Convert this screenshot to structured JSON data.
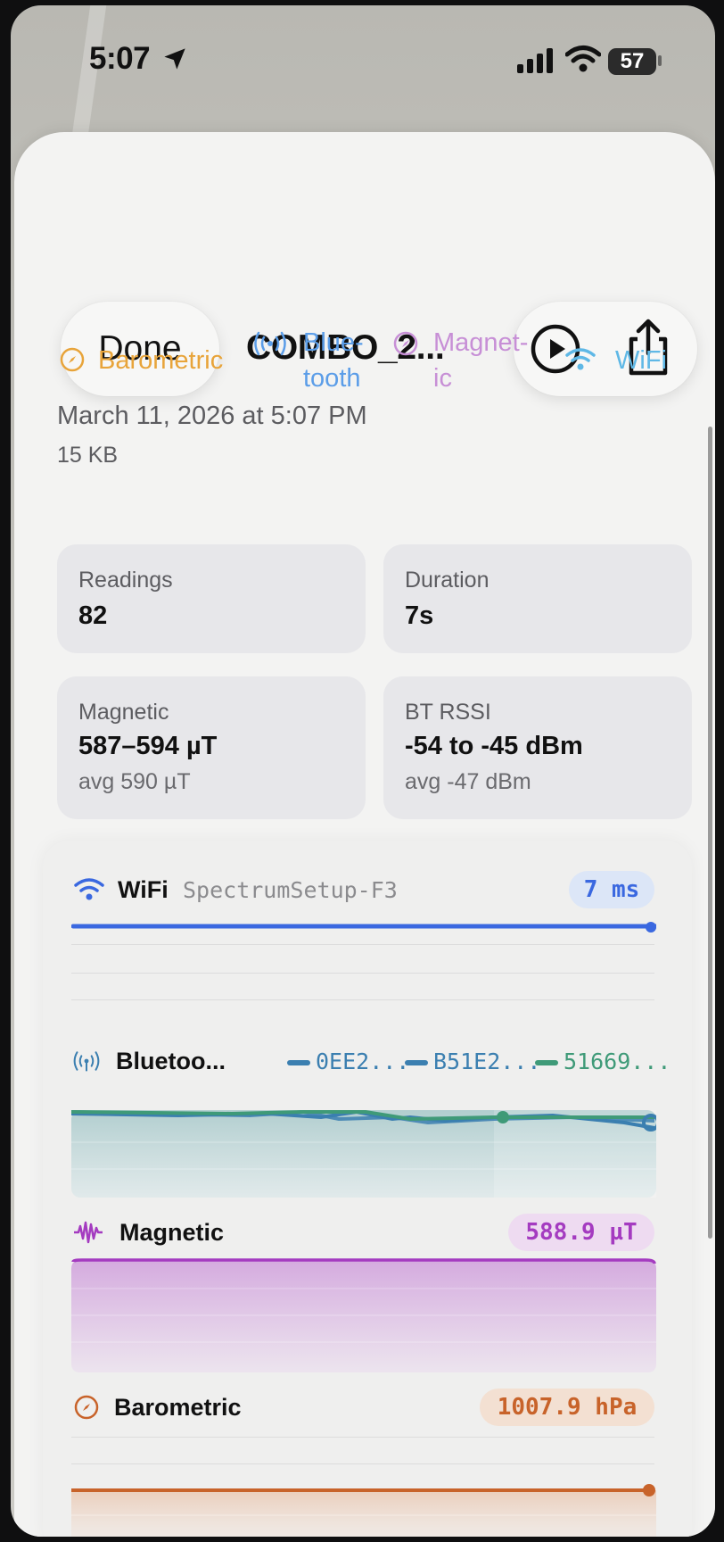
{
  "status_bar": {
    "time": "5:07",
    "battery": "57"
  },
  "header": {
    "done_label": "Done",
    "title": "COMBO_2..."
  },
  "tags": [
    {
      "label": "Barometric",
      "color": "#e8a43a",
      "icon": "compass-icon"
    },
    {
      "label": "Blue-\ntooth",
      "color": "#5b9de8",
      "icon": "antenna-icon"
    },
    {
      "label": "Magnet-\nic",
      "color": "#c78fd6",
      "icon": "compass-icon"
    },
    {
      "label": "WiFi",
      "color": "#5fb8e6",
      "icon": "wifi-icon"
    }
  ],
  "recording": {
    "date": "March 11, 2026 at 5:07 PM",
    "size": "15 KB"
  },
  "stats": {
    "readings": {
      "label": "Readings",
      "value": "82"
    },
    "duration": {
      "label": "Duration",
      "value": "7s"
    },
    "magnetic": {
      "label": "Magnetic",
      "value": "587–594 µT",
      "avg": "avg 590 µT"
    },
    "bt_rssi": {
      "label": "BT RSSI",
      "value": "-54 to -45 dBm",
      "avg": "avg -47 dBm"
    }
  },
  "charts": {
    "wifi": {
      "label": "WiFi",
      "network": "SpectrumSetup-F3",
      "badge": "7 ms",
      "color": "#3a68e0"
    },
    "bluetooth": {
      "label": "Bluetoo...",
      "devices": [
        "0EE2...",
        "B51E2...",
        "51669..."
      ],
      "device_colors": [
        "#3b7fb0",
        "#3b7fb0",
        "#3f9a78"
      ]
    },
    "magnetic": {
      "label": "Magnetic",
      "badge": "588.9 µT",
      "color": "#a43bc0"
    },
    "barometric": {
      "label": "Barometric",
      "badge": "1007.9 hPa",
      "color": "#c8632a"
    }
  }
}
